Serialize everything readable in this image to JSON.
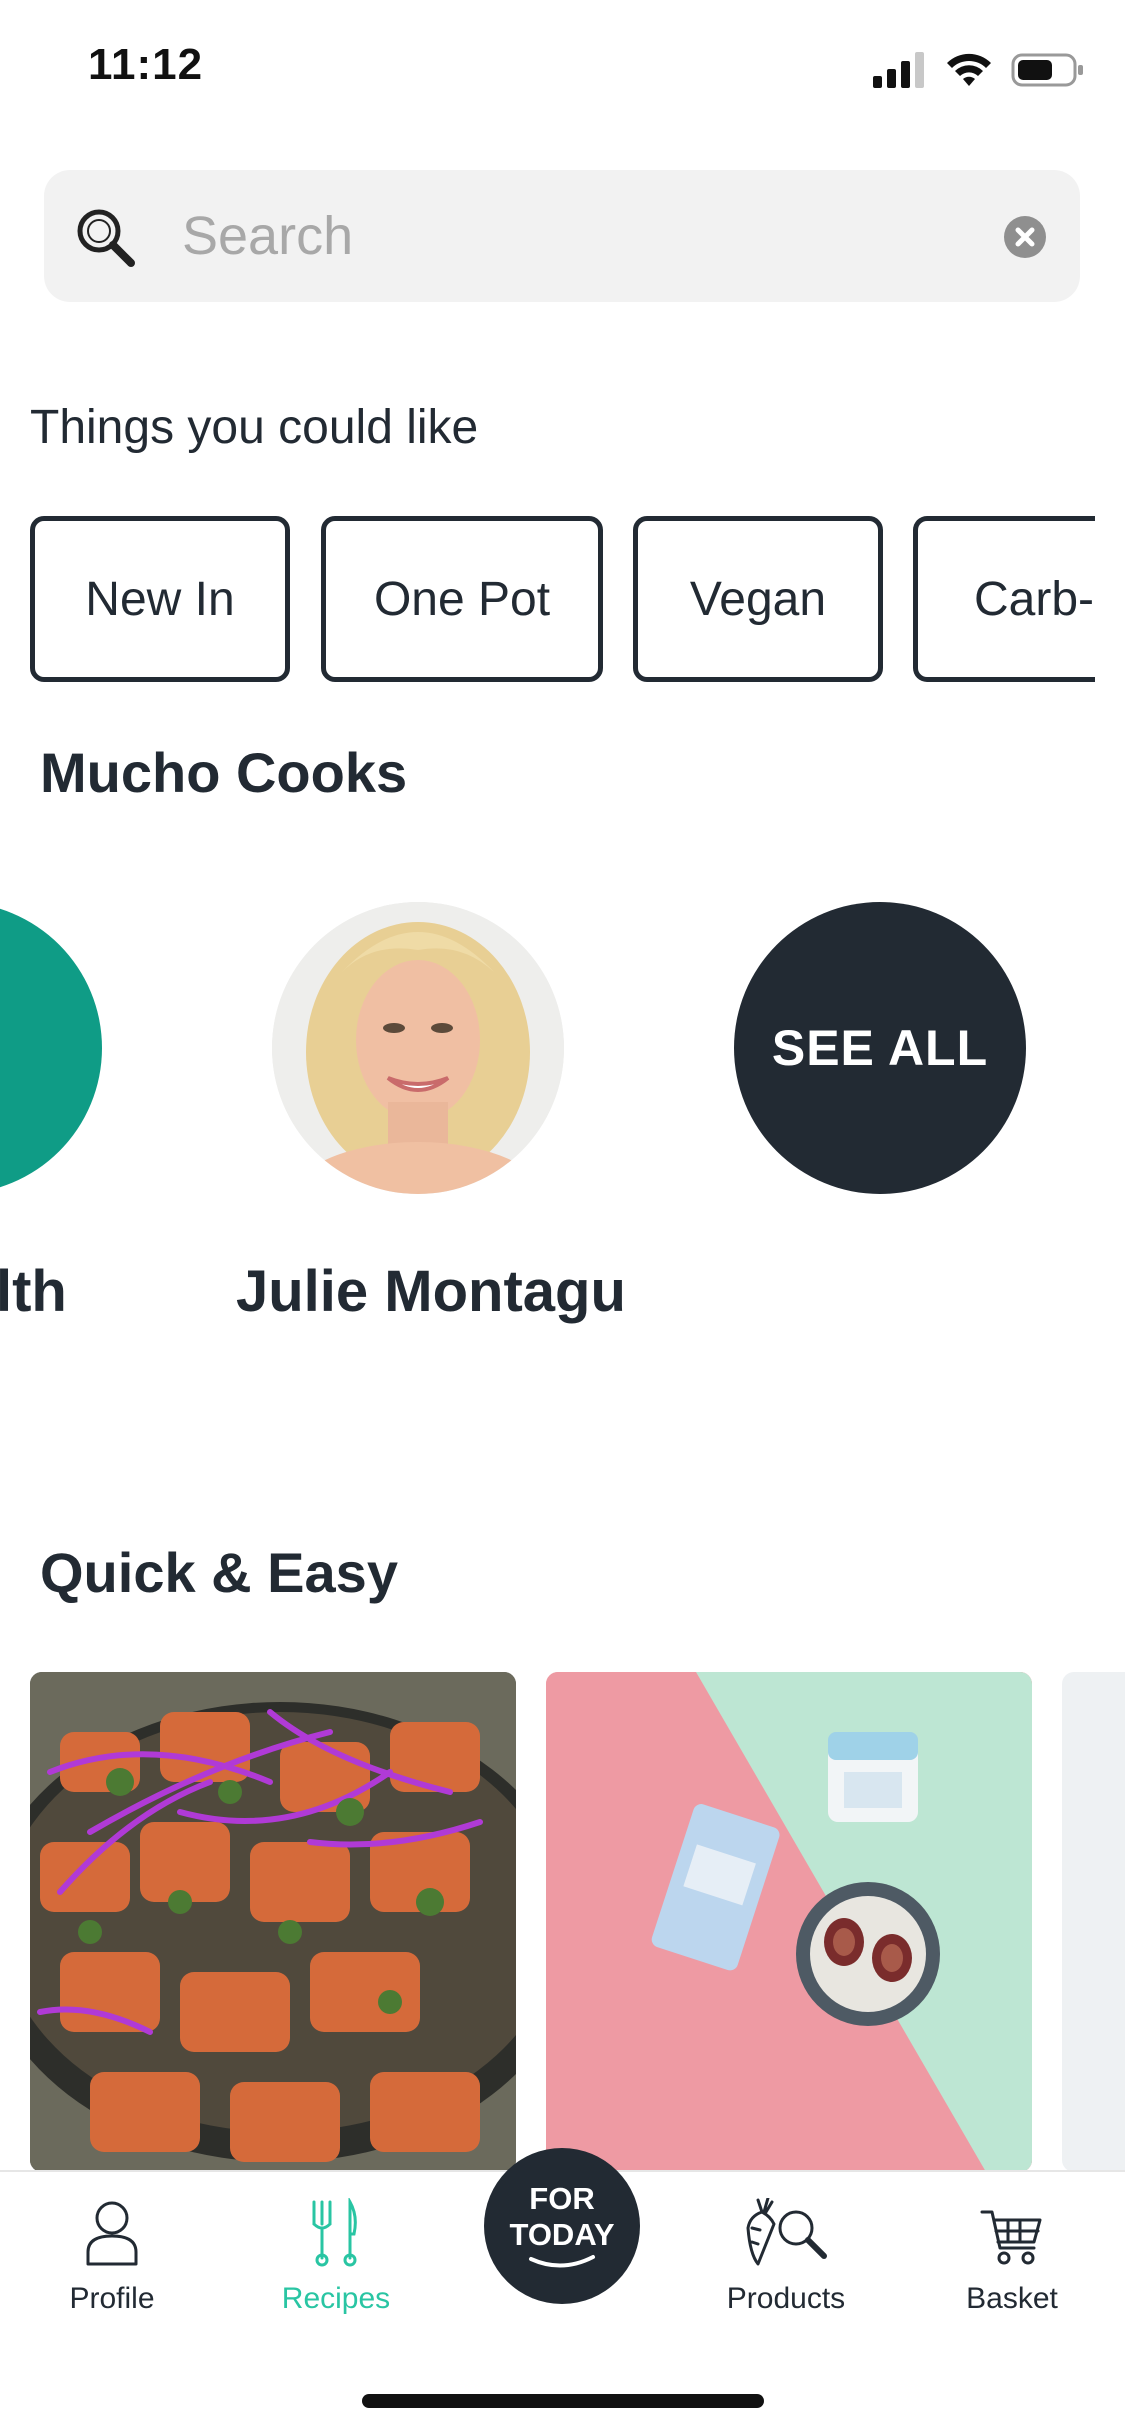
{
  "status_bar": {
    "time": "11:12"
  },
  "search": {
    "placeholder": "Search"
  },
  "suggestions": {
    "title": "Things you could like",
    "chips": [
      "New In",
      "One Pot",
      "Vegan",
      "Carb-"
    ]
  },
  "cooks": {
    "title": "Mucho Cooks",
    "items": [
      {
        "name": "lth",
        "color": "#0f9c86"
      },
      {
        "name": "Julie Montagu"
      }
    ],
    "see_all_label": "SEE ALL"
  },
  "quick_easy": {
    "title": "Quick & Easy"
  },
  "tab_bar": {
    "tabs": [
      {
        "label": "Profile",
        "icon": "person-icon",
        "active": false
      },
      {
        "label": "Recipes",
        "icon": "fork-knife-icon",
        "active": true
      },
      {
        "label": "Products",
        "icon": "carrot-search-icon",
        "active": false
      },
      {
        "label": "Basket",
        "icon": "cart-icon",
        "active": false
      }
    ],
    "center_button": {
      "line1": "FOR",
      "line2": "TODAY"
    }
  },
  "colors": {
    "accent": "#29c5a3",
    "dark": "#222a33",
    "teal_cook": "#0f9c86"
  }
}
